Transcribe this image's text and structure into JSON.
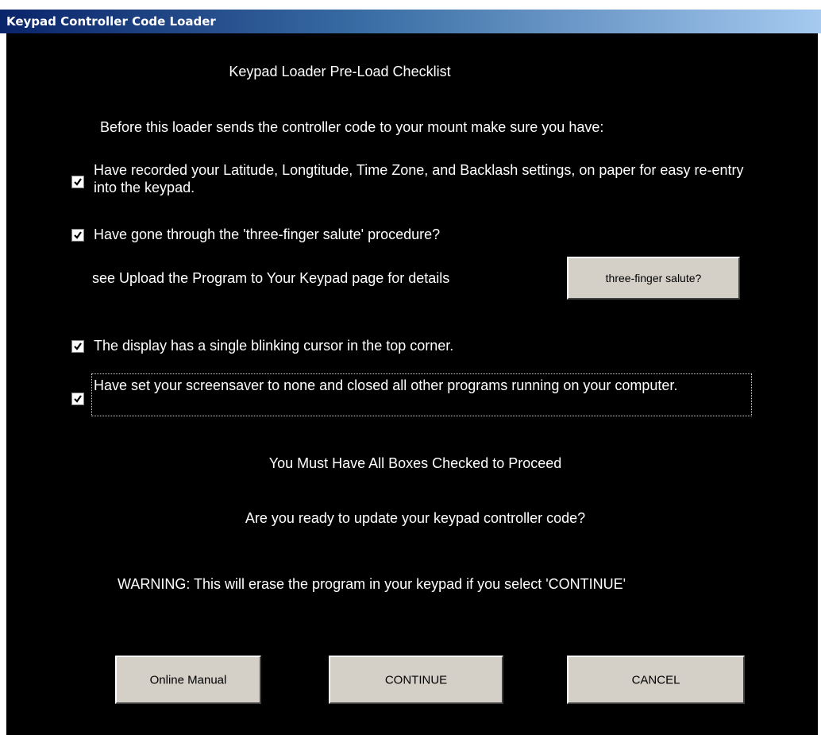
{
  "window": {
    "title": "Keypad Controller Code Loader"
  },
  "checklist": {
    "heading": "Keypad Loader Pre-Load Checklist",
    "intro": "Before this loader sends the controller code to your mount make sure you have:",
    "items": [
      {
        "label": "Have recorded your Latitude, Longtitude, Time Zone, and Backlash settings, on paper for easy re-entry into the keypad.",
        "checked": true
      },
      {
        "label": "Have gone through the 'three-finger salute' procedure?",
        "checked": true
      },
      {
        "label": "The display has a single blinking cursor in the top corner.",
        "checked": true
      },
      {
        "label": "Have set your screensaver to none and closed all other programs running on your computer.",
        "checked": true
      }
    ],
    "see_upload_text": "see Upload the Program to Your Keypad page for details",
    "salute_button": "three-finger salute?"
  },
  "messages": {
    "must_check": "You Must Have All Boxes Checked to Proceed",
    "ready_question": "Are you ready to update your keypad controller code?",
    "warning": "WARNING: This will erase the program in your keypad if you select 'CONTINUE'"
  },
  "buttons": {
    "online_manual": "Online Manual",
    "continue": "CONTINUE",
    "cancel": "CANCEL"
  }
}
